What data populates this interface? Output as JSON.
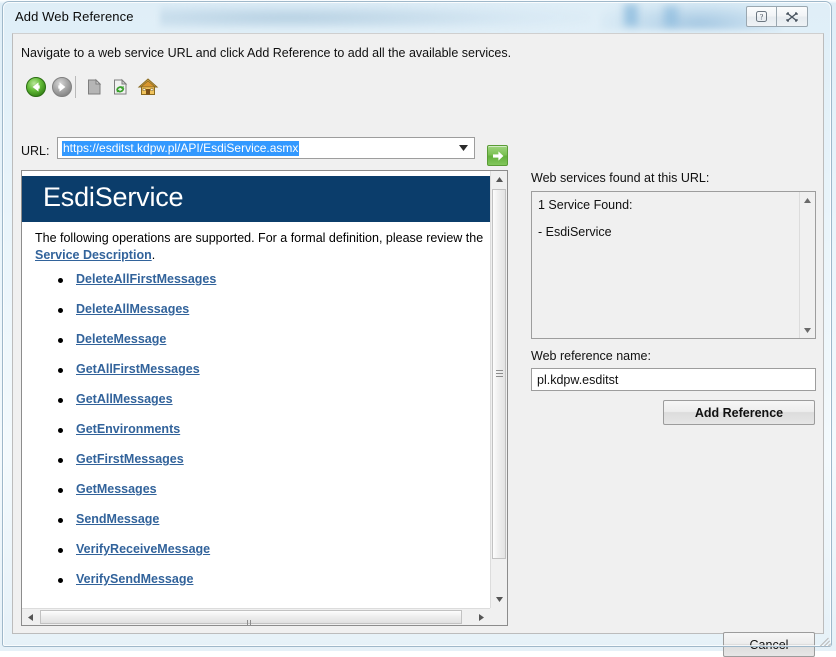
{
  "window": {
    "title": "Add Web Reference",
    "help_glyph": "?",
    "close_glyph": "✕"
  },
  "instruction": "Navigate to a web service URL and click Add Reference to add all the available services.",
  "toolbar": {
    "buttons": [
      {
        "name": "back-button",
        "tooltip": "Back"
      },
      {
        "name": "forward-button",
        "tooltip": "Forward"
      },
      {
        "name": "stop-button",
        "tooltip": "Stop"
      },
      {
        "name": "refresh-button",
        "tooltip": "Refresh"
      },
      {
        "name": "home-button",
        "tooltip": "Home"
      }
    ]
  },
  "url_row": {
    "label": "URL:",
    "value": "https://esditst.kdpw.pl/API/EsdiService.asmx",
    "placeholder": "",
    "selected": true,
    "selection_color": "#3399ff",
    "go_button_label": "Go"
  },
  "browser": {
    "service_title": "EsdiService",
    "description_prefix": "The following operations are supported. For a formal definition, please review the ",
    "description_link": "Service Description",
    "description_suffix": ".",
    "header_color": "#0b3d6b",
    "link_color": "#32639b",
    "operations": [
      "DeleteAllFirstMessages",
      "DeleteAllMessages",
      "DeleteMessage",
      "GetAllFirstMessages",
      "GetAllMessages",
      "GetEnvironments",
      "GetFirstMessages",
      "GetMessages",
      "SendMessage",
      "VerifyReceiveMessage",
      "VerifySendMessage"
    ]
  },
  "services_panel": {
    "label": "Web services found at this URL:",
    "found_text": "1 Service Found:",
    "items": [
      "- EsdiService"
    ]
  },
  "reference_name": {
    "label": "Web reference name:",
    "value": "pl.kdpw.esditst",
    "placeholder": ""
  },
  "buttons": {
    "add_reference": "Add Reference",
    "cancel": "Cancel"
  }
}
